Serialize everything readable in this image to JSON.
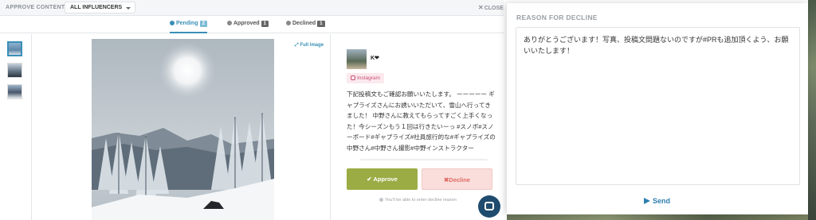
{
  "topbar": {
    "approve_label": "APPROVE CONTENT",
    "filter_value": "ALL INFLUENCERS",
    "close_label": "CLOSE"
  },
  "tabs": [
    {
      "label": "Pending",
      "count": "2"
    },
    {
      "label": "Approved",
      "count": "1"
    },
    {
      "label": "Declined",
      "count": "1"
    }
  ],
  "viewer": {
    "full_image_label": "Full Image"
  },
  "post": {
    "username": "K❤",
    "platform": "Instagram",
    "caption": "下記投稿文もご確認お願いいたします。 ーーーーー ギャプライズさんにお誘いいただいて、雪山へ行ってきました！ 中野さんに教えてもらってすごく上手くなった！今シーズンもう１回は行きたいーっ #スノボ#スノーボード#ギャプライズ#社員旅行的な#ギャプライズの中野さん#中野さん撮影#中野インストラクター",
    "approve_label": "Approve",
    "decline_label": "Decline",
    "hint": "You'll be able to enter decline reason"
  },
  "modal": {
    "title": "REASON FOR DECLINE",
    "reason_text": "ありがとうございます！写真、投稿文問題ないのですが#PRも追加頂くよう、お願いいたします！",
    "send_label": "Send"
  }
}
